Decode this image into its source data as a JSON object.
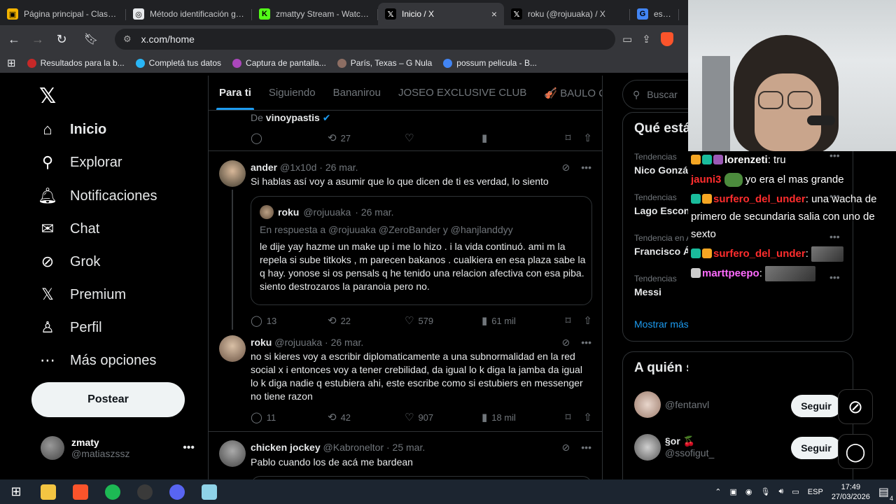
{
  "browser": {
    "tabs": [
      {
        "label": "Página principal - Classroom",
        "fav_color": "#f4b400",
        "fav_glyph": "▣"
      },
      {
        "label": "Método identificación gráfica",
        "fav_color": "#e8eaed",
        "fav_glyph": "◎"
      },
      {
        "label": "zmattyy Stream - Watch Live",
        "fav_color": "#53fc18",
        "fav_glyph": "K"
      },
      {
        "label": "Inicio / X",
        "fav_color": "#000000",
        "fav_glyph": "𝕏",
        "active": true
      },
      {
        "label": "roku (@rojuuaka) / X",
        "fav_color": "#000000",
        "fav_glyph": "𝕏"
      },
      {
        "label": "escena de",
        "fav_color": "#4285f4",
        "fav_glyph": "G"
      }
    ],
    "close_glyph": "×",
    "url": "x.com/home",
    "bookmarks": [
      {
        "label": "Resultados para la b...",
        "color": "#c62828"
      },
      {
        "label": "Completá tus datos",
        "color": "#29b6f6"
      },
      {
        "label": "Captura de pantalla...",
        "color": "#ab47bc"
      },
      {
        "label": "París, Texas – G Nula",
        "color": "#8d6e63"
      },
      {
        "label": "possum pelicula - B...",
        "color": "#4285f4"
      }
    ]
  },
  "nav": {
    "items": [
      {
        "label": "Inicio",
        "icon": "home-icon",
        "glyph": "⌂",
        "active": true
      },
      {
        "label": "Explorar",
        "icon": "search-icon",
        "glyph": "⚲"
      },
      {
        "label": "Notificaciones",
        "icon": "bell-icon",
        "glyph": "🔔︎"
      },
      {
        "label": "Chat",
        "icon": "mail-icon",
        "glyph": "✉"
      },
      {
        "label": "Grok",
        "icon": "grok-icon",
        "glyph": "⊘"
      },
      {
        "label": "Premium",
        "icon": "x-premium-icon",
        "glyph": "𝕏"
      },
      {
        "label": "Perfil",
        "icon": "person-icon",
        "glyph": "♙"
      },
      {
        "label": "Más opciones",
        "icon": "more-circle-icon",
        "glyph": "⋯"
      }
    ],
    "post_label": "Postear",
    "account_name": "zmaty",
    "account_handle": "@matiaszssz"
  },
  "feed": {
    "tabs": [
      "Para ti",
      "Siguiendo",
      "Bananirou",
      "JOSEO EXCLUSIVE CLUB",
      "🎻 BAULO CL"
    ],
    "top_item": {
      "prefix": "De",
      "author": "vinoypastis",
      "retweets": "27"
    },
    "tweets": [
      {
        "name": "ander",
        "handle": "@1x10d",
        "date": "· 26 mar.",
        "text": "Si hablas así voy a asumir que lo que dicen de ti es verdad, lo siento",
        "quote": {
          "name": "roku",
          "handle": "@rojuuaka",
          "date": "· 26 mar.",
          "reply_prefix": "En respuesta a",
          "reply_to": "@rojuuaka @ZeroBander y @hanjlanddyy",
          "text": "le dije yay hazme un make up i me lo hizo . i la vida continuó. ami m la repela si sube titkoks , m parecen bakanos . cualkiera en esa plaza sabe la q hay. yonose si os pensals q he tenido una relacion afectiva con esa piba. siento destrozaros la paranoia pero no."
        },
        "replies": "13",
        "retweets": "22",
        "likes": "579",
        "views": "61 mil"
      },
      {
        "name": "roku",
        "handle": "@rojuuaka",
        "date": "· 26 mar.",
        "text": "no si kieres voy a escribir diplomaticamente a una subnormalidad en la red social x i entonces voy a tener crebilidad, da igual lo k diga la jamba da igual lo k diga nadie q estubiera ahi, este escribe como si estubiers en messenger no tiene razon",
        "replies": "11",
        "retweets": "42",
        "likes": "907",
        "views": "18 mil"
      },
      {
        "name": "chicken jockey",
        "handle": "@Kabroneltor",
        "date": "· 25 mar.",
        "text": "Pablo cuando los de acá me bardean"
      }
    ]
  },
  "sidebar": {
    "search_placeholder": "Buscar",
    "trends_title": "Qué está",
    "trends": [
      {
        "context": "Tendencias",
        "name": "Nico González"
      },
      {
        "context": "Tendencias",
        "name": "Lago Escondido"
      },
      {
        "context": "Tendencia en Argentina",
        "name": "Francisco Álv"
      },
      {
        "context": "Tendencias",
        "name": "Messi"
      }
    ],
    "show_more": "Mostrar más",
    "follow_title": "A quién seguir",
    "follow": [
      {
        "name": "",
        "handle": "@fentanvl",
        "button": "Seguir"
      },
      {
        "name": "§or 🍒",
        "handle": "@ssofigut_",
        "button": "Seguir"
      }
    ]
  },
  "stream_chat": [
    {
      "user": "lorenzeti",
      "user_color": "#ffffff",
      "text": "tru",
      "badges": [
        "#f5a623",
        "#1abc9c",
        "#9b59b6"
      ]
    },
    {
      "user": "jauni3",
      "user_color": "#ff2d2d",
      "text": "yo era el mas grande",
      "pepe": true
    },
    {
      "user": "surfero_del_under",
      "user_color": "#ff2d2d",
      "text": "una wacha de primero de secundaria salia con uno de sexto",
      "badges": [
        "#1abc9c",
        "#f5a623"
      ]
    },
    {
      "user": "surfero_del_under",
      "user_color": "#ff2d2d",
      "text": "",
      "badges": [
        "#1abc9c",
        "#f5a623"
      ],
      "emote": true
    },
    {
      "user": "marttpeepo",
      "user_color": "#ff6bff",
      "text": "",
      "badges": [
        "#cccccc"
      ],
      "emote_wide": true
    }
  ],
  "taskbar": {
    "apps": [
      "file-explorer-icon",
      "brave-icon",
      "spotify-icon",
      "obs-icon",
      "discord-icon",
      "app-icon"
    ],
    "lang": "ESP",
    "time": "17:49",
    "date": "27/03/2026",
    "notif_count": "4"
  }
}
